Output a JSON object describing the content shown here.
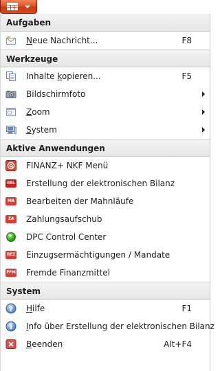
{
  "app_button": {
    "icon": "grid-icon",
    "dropdown_icon": "caret-down-icon",
    "color": "#e0542a"
  },
  "sections": {
    "tasks": {
      "title": "Aufgaben",
      "items": {
        "new_message": {
          "prefix": "",
          "key": "N",
          "rest": "eue Nachricht...",
          "shortcut": "F8",
          "icon": "envelope-icon"
        }
      }
    },
    "tools": {
      "title": "Werkzeuge",
      "items": {
        "copy_content": {
          "prefix": "Inhalte ",
          "key": "k",
          "rest": "opieren...",
          "shortcut": "F5",
          "icon": "copy-icon"
        },
        "screenshot": {
          "prefix": "Bildschirmfoto",
          "key": "",
          "rest": "",
          "icon": "camera-icon",
          "submenu": true
        },
        "zoom": {
          "prefix": "",
          "key": "Z",
          "rest": "oom",
          "icon": "zoom-window-icon",
          "submenu": true
        },
        "system": {
          "prefix": "",
          "key": "S",
          "rest": "ystem",
          "icon": "computer-icon",
          "submenu": true
        }
      }
    },
    "active_apps": {
      "title": "Aktive Anwendungen",
      "items": {
        "finanz_menu": {
          "label": "FINANZ+ NKF Menü",
          "icon": "at-icon"
        },
        "ebil": {
          "label": "Erstellung der elektronischen Bilanz",
          "icon": "ebl-badge-icon",
          "badge": "EBL"
        },
        "dunning": {
          "label": "Bearbeiten der Mahnläufe",
          "icon": "ma-badge-icon",
          "badge": "MA"
        },
        "payment_deferral": {
          "label": "Zahlungsaufschub",
          "icon": "za-badge-icon",
          "badge": "ZA"
        },
        "dpc": {
          "label": "DPC Control Center",
          "icon": "green-circle-icon"
        },
        "mandates": {
          "label": "Einzugsermächtigungen / Mandate",
          "icon": "bez-badge-icon",
          "badge": "BEZ"
        },
        "third_party_funds": {
          "label": "Fremde Finanzmittel",
          "icon": "ffm-badge-icon",
          "badge": "FFM"
        }
      }
    },
    "system": {
      "title": "System",
      "items": {
        "help": {
          "prefix": "",
          "key": "H",
          "rest": "ilfe",
          "shortcut": "F1",
          "icon": "help-icon"
        },
        "info": {
          "prefix": "",
          "key": "I",
          "rest": "nfo über Erstellung der elektronischen Bilanz",
          "icon": "info-icon"
        },
        "exit": {
          "prefix": "",
          "key": "B",
          "rest": "eenden",
          "shortcut": "Alt+F4",
          "icon": "close-icon"
        }
      }
    }
  }
}
